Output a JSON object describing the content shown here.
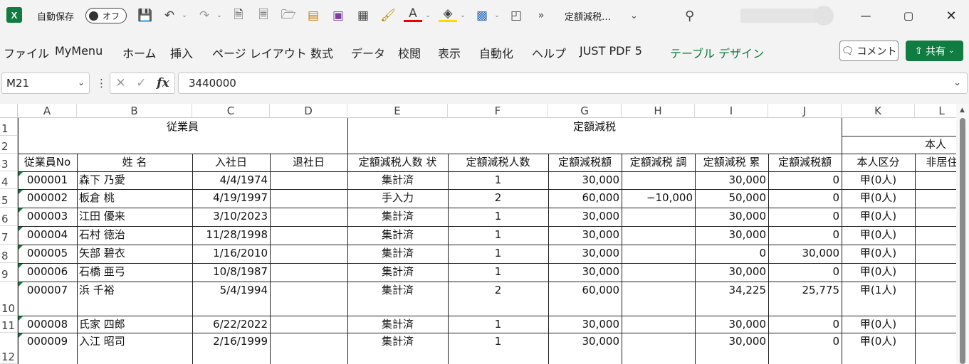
{
  "titlebar": {
    "autosave_label": "自動保存",
    "autosave_state": "オフ",
    "doc_title": "定額減税…",
    "icons": [
      "save-icon",
      "undo-icon",
      "redo-icon",
      "new-file-icon",
      "print-preview-icon",
      "open-folder-icon",
      "picture-icon",
      "form-icon",
      "spreadsheet-icon",
      "format-painter-icon",
      "font-color-icon",
      "fill-color-icon",
      "textbox-icon",
      "object-icon",
      "more-icon"
    ]
  },
  "menu": {
    "items": [
      "ファイル",
      "MyMenu",
      "ホーム",
      "挿入",
      "ページ レイアウト",
      "数式",
      "データ",
      "校閲",
      "表示",
      "自動化",
      "ヘルプ",
      "JUST PDF 5",
      "テーブル デザイン"
    ],
    "comment_label": "コメント",
    "share_label": "共有"
  },
  "formula_bar": {
    "name_box": "M21",
    "formula": "3440000"
  },
  "grid": {
    "columns": [
      "A",
      "B",
      "C",
      "D",
      "E",
      "F",
      "G",
      "H",
      "I",
      "J",
      "K",
      "L"
    ],
    "row_numbers": [
      "1",
      "2",
      "3",
      "4",
      "5",
      "6",
      "7",
      "8",
      "9",
      "10",
      "11",
      "12"
    ],
    "group_header_employee": "従業員",
    "group_header_tax": "定額減税",
    "group_header_self": "本人",
    "headers": [
      "従業員No",
      "姓 名",
      "入社日",
      "退社日",
      "定額減税人数 状",
      "定額減税人数",
      "定額減税額",
      "定額減税 調",
      "定額減税 累",
      "定額減税額",
      "本人区分",
      "非居住"
    ],
    "rows": [
      [
        "000001",
        "森下 乃愛",
        "4/4/1974",
        "",
        "集計済",
        "1",
        "30,000",
        "",
        "30,000",
        "0",
        "甲(0人)"
      ],
      [
        "000002",
        "板倉 桃",
        "4/19/1997",
        "",
        "手入力",
        "2",
        "60,000",
        "−10,000",
        "50,000",
        "0",
        "甲(0人)"
      ],
      [
        "000003",
        "江田 優来",
        "3/10/2023",
        "",
        "集計済",
        "1",
        "30,000",
        "",
        "30,000",
        "0",
        "甲(0人)"
      ],
      [
        "000004",
        "石村 徳治",
        "11/28/1998",
        "",
        "集計済",
        "1",
        "30,000",
        "",
        "30,000",
        "0",
        "甲(0人)"
      ],
      [
        "000005",
        "矢部 碧衣",
        "1/16/2010",
        "",
        "集計済",
        "1",
        "30,000",
        "",
        "0",
        "30,000",
        "甲(0人)"
      ],
      [
        "000006",
        "石橋 亜弓",
        "10/8/1987",
        "",
        "集計済",
        "1",
        "30,000",
        "",
        "30,000",
        "0",
        "甲(0人)"
      ],
      [
        "000007",
        "浜 千裕",
        "5/4/1994",
        "",
        "集計済",
        "2",
        "60,000",
        "",
        "34,225",
        "25,775",
        "甲(1人)"
      ],
      [
        "000008",
        "氏家 四郎",
        "6/22/2022",
        "",
        "集計済",
        "1",
        "30,000",
        "",
        "30,000",
        "0",
        "甲(0人)"
      ],
      [
        "000009",
        "入江 昭司",
        "2/16/1999",
        "",
        "集計済",
        "1",
        "30,000",
        "",
        "30,000",
        "0",
        "甲(0人)"
      ]
    ]
  }
}
